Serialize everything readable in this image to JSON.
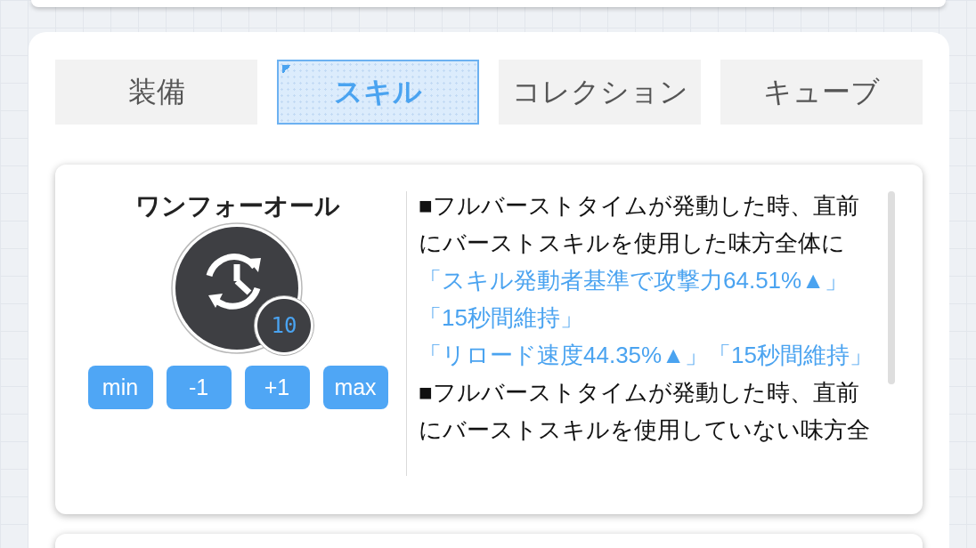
{
  "tabs": [
    {
      "label": "装備",
      "selected": false
    },
    {
      "label": "スキル",
      "selected": true
    },
    {
      "label": "コレクション",
      "selected": false
    },
    {
      "label": "キューブ",
      "selected": false
    }
  ],
  "skill": {
    "name": "ワンフォーオール",
    "level": "10",
    "buttons": [
      "min",
      "-1",
      "+1",
      "max"
    ],
    "description": [
      {
        "kind": "text",
        "text": "■フルバーストタイムが発動した時、直前にバーストスキルを使用した味方全体に"
      },
      {
        "kind": "highlight",
        "text": "「スキル発動者基準で攻撃力64.51%▲」"
      },
      {
        "kind": "highlight",
        "text": "「15秒間維持」"
      },
      {
        "kind": "highlight",
        "text": "「リロード速度44.35%▲」「15秒間維持」"
      },
      {
        "kind": "text",
        "text": "■フルバーストタイムが発動した時、直前にバーストスキルを使用していない味方全"
      }
    ]
  }
}
